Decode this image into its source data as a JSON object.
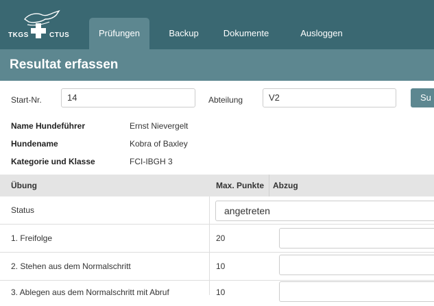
{
  "logo": {
    "left_text": "TKGS",
    "right_text": "CTUS"
  },
  "nav": {
    "tabs": [
      {
        "label": "Prüfungen",
        "active": true
      },
      {
        "label": "Backup",
        "active": false
      },
      {
        "label": "Dokumente",
        "active": false
      },
      {
        "label": "Ausloggen",
        "active": false
      }
    ]
  },
  "page": {
    "title": "Resultat erfassen"
  },
  "search": {
    "start_label": "Start-Nr.",
    "start_value": "14",
    "abteilung_label": "Abteilung",
    "abteilung_value": "V2",
    "search_button": "Su"
  },
  "info": [
    {
      "label": "Name Hundeführer",
      "value": "Ernst Nievergelt"
    },
    {
      "label": "Hundename",
      "value": "Kobra of Baxley"
    },
    {
      "label": "Kategorie und Klasse",
      "value": "FCI-IBGH 3"
    }
  ],
  "table": {
    "headers": {
      "uebung": "Übung",
      "max": "Max. Punkte",
      "abzug": "Abzug"
    },
    "status_row": {
      "label": "Status",
      "value": "angetreten"
    },
    "rows": [
      {
        "label": "1. Freifolge",
        "max": "20"
      },
      {
        "label": "2. Stehen aus dem Normalschritt",
        "max": "10"
      },
      {
        "label": "3. Ablegen aus dem Normalschritt mit Abruf",
        "max": "10"
      }
    ]
  },
  "colors": {
    "nav_bg": "#3a6872",
    "accent": "#5d8790",
    "header_bg": "#e4e4e4"
  }
}
